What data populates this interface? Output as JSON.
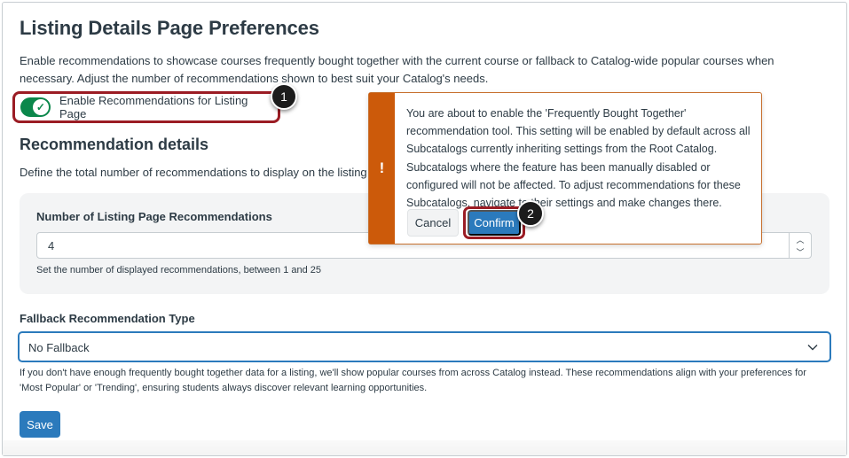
{
  "page": {
    "title": "Listing Details Page Preferences",
    "intro": "Enable recommendations to showcase courses frequently bought together with the current course or fallback to Catalog-wide popular courses when necessary. Adjust the number of recommendations shown to best suit your Catalog's needs."
  },
  "toggle": {
    "label": "Enable Recommendations for Listing Page",
    "state": "on",
    "check_glyph": "✓"
  },
  "callouts": {
    "one": "1",
    "two": "2"
  },
  "recommendation_details": {
    "title": "Recommendation details",
    "description": "Define the total number of recommendations to display on the listing de",
    "count_label": "Number of Listing Page Recommendations",
    "count_value": "4",
    "count_hint": "Set the number of displayed recommendations, between 1 and 25",
    "step_up": "︿",
    "step_down": "﹀"
  },
  "fallback": {
    "label": "Fallback Recommendation Type",
    "selected": "No Fallback",
    "description": "If you don't have enough frequently bought together data for a listing, we'll show popular courses from across Catalog instead. These recommendations align with your preferences for 'Most Popular' or 'Trending', ensuring students always discover relevant learning opportunities."
  },
  "save_label": "Save",
  "alert": {
    "icon": "!",
    "message": "You are about to enable the 'Frequently Bought Together' recommendation tool. This setting will be enabled by default across all Subcatalogs currently inheriting settings from the Root Catalog. Subcatalogs where the feature has been manually disabled or configured will not be affected. To adjust recommendations for these Subcatalogs, navigate to their settings and make changes there.",
    "cancel_label": "Cancel",
    "confirm_label": "Confirm"
  },
  "colors": {
    "accent": "#2b7abc",
    "toggle_on": "#0b874b",
    "warning": "#cc5a0a",
    "highlight_border": "#9b1c24"
  }
}
